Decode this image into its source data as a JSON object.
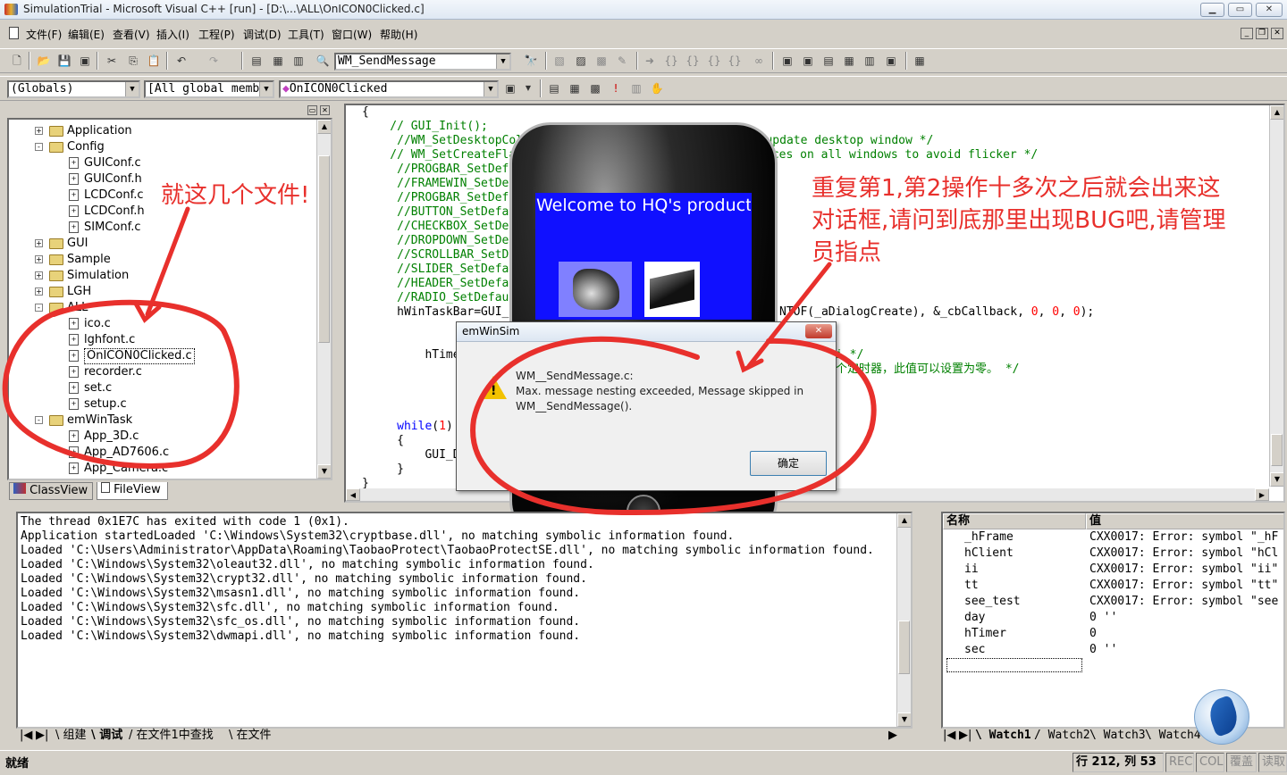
{
  "window": {
    "title": "SimulationTrial - Microsoft Visual C++ [run] - [D:\\...\\ALL\\OnICON0Clicked.c]"
  },
  "menu": [
    "文件(F)",
    "编辑(E)",
    "查看(V)",
    "插入(I)",
    "工程(P)",
    "调试(D)",
    "工具(T)",
    "窗口(W)",
    "帮助(H)"
  ],
  "toolbar": {
    "find_combo": "WM_SendMessage",
    "scope": "(Globals)",
    "members": "[All global members",
    "function": "OnICON0Clicked"
  },
  "tree": [
    {
      "label": "Application",
      "kind": "folder",
      "sign": "+"
    },
    {
      "label": "Config",
      "kind": "folder",
      "sign": "-"
    },
    {
      "label": "GUIConf.c",
      "kind": "file"
    },
    {
      "label": "GUIConf.h",
      "kind": "file"
    },
    {
      "label": "LCDConf.c",
      "kind": "file"
    },
    {
      "label": "LCDConf.h",
      "kind": "file"
    },
    {
      "label": "SIMConf.c",
      "kind": "file"
    },
    {
      "label": "GUI",
      "kind": "folder",
      "sign": "+"
    },
    {
      "label": "Sample",
      "kind": "folder",
      "sign": "+"
    },
    {
      "label": "Simulation",
      "kind": "folder",
      "sign": "+"
    },
    {
      "label": "LGH",
      "kind": "folder",
      "sign": "+"
    },
    {
      "label": "ALL",
      "kind": "folder",
      "sign": "-"
    },
    {
      "label": "ico.c",
      "kind": "file"
    },
    {
      "label": "lghfont.c",
      "kind": "file"
    },
    {
      "label": "OnICON0Clicked.c",
      "kind": "file",
      "selected": true
    },
    {
      "label": "recorder.c",
      "kind": "file"
    },
    {
      "label": "set.c",
      "kind": "file"
    },
    {
      "label": "setup.c",
      "kind": "file"
    },
    {
      "label": "emWinTask",
      "kind": "folder",
      "sign": "-"
    },
    {
      "label": "App_3D.c",
      "kind": "file"
    },
    {
      "label": "App_AD7606.c",
      "kind": "file"
    },
    {
      "label": "App_Camera.c",
      "kind": "file"
    }
  ],
  "tree_tabs": [
    "ClassView",
    "FileView"
  ],
  "code": {
    "l0": "{",
    "l1": "    // GUI_Init();",
    "l2a": "     //WM_SetDesktopColor(",
    "l2b": "ly update desktop window */",
    "l3a": "    // WM_SetCreateFlag",
    "l3b": "ices on all windows to avoid flicker */",
    "l4": "     //PROGBAR_SetDefa",
    "l5": "     //FRAMEWIN_SetDef",
    "l6": "     //PROGBAR_SetDef",
    "l7": "     //BUTTON_SetDefa",
    "l8": "     //CHECKBOX_SetDe",
    "l9": "     //DROPDOWN_SetDe",
    "l10": "     //SCROLLBAR_SetD",
    "l11": "     //SLIDER_SetDefa",
    "l12": "     //HEADER_SetDefa",
    "l13": "     //RADIO_SetDefaul",
    "l14a": "     hWinTaskBar=GUI_",
    "l14b": "NTOF(_aDialogCreate), &_cbCallback, ",
    "l14z": "0",
    "l14c": ");",
    "l15a": "         hTime",
    "l15b": "i */",
    "l16": "个定时器，此值可以设置为零。 */",
    "l17a": "     ",
    "l17kw": "while",
    "l17b": "(",
    "l17one": "1",
    "l17c": ")",
    "l18": "     {",
    "l19": "         GUI_D",
    "l20": "     }",
    "l21": "}"
  },
  "sim": {
    "welcome": "Welcome to HQ's products"
  },
  "dialog": {
    "title": "emWinSim",
    "line1": "WM__SendMessage.c:",
    "line2": "Max. message nesting exceeded, Message skipped in",
    "line3": "WM__SendMessage().",
    "ok": "确定"
  },
  "output": [
    "The thread 0x1E7C has exited with code 1 (0x1).",
    "Application startedLoaded 'C:\\Windows\\System32\\cryptbase.dll', no matching symbolic information found.",
    "Loaded 'C:\\Users\\Administrator\\AppData\\Roaming\\TaobaoProtect\\TaobaoProtectSE.dll', no matching symbolic information found.",
    "Loaded 'C:\\Windows\\System32\\oleaut32.dll', no matching symbolic information found.",
    "Loaded 'C:\\Windows\\System32\\crypt32.dll', no matching symbolic information found.",
    "Loaded 'C:\\Windows\\System32\\msasn1.dll', no matching symbolic information found.",
    "Loaded 'C:\\Windows\\System32\\sfc.dll', no matching symbolic information found.",
    "Loaded 'C:\\Windows\\System32\\sfc_os.dll', no matching symbolic information found.",
    "Loaded 'C:\\Windows\\System32\\dwmapi.dll', no matching symbolic information found."
  ],
  "output_tabs": [
    "组建",
    "调试",
    "在文件1中查找",
    "在文件"
  ],
  "watch": {
    "col_name": "名称",
    "col_value": "值",
    "rows": [
      {
        "name": "_hFrame",
        "value": "CXX0017: Error: symbol \"_hF"
      },
      {
        "name": "hClient",
        "value": "CXX0017: Error: symbol \"hCl"
      },
      {
        "name": "ii",
        "value": "CXX0017: Error: symbol \"ii\""
      },
      {
        "name": "tt",
        "value": "CXX0017: Error: symbol \"tt\""
      },
      {
        "name": "see_test",
        "value": "CXX0017: Error: symbol \"see"
      },
      {
        "name": "day",
        "value": "0 ''"
      },
      {
        "name": "hTimer",
        "value": "0"
      },
      {
        "name": "sec",
        "value": "0 ''"
      }
    ],
    "tabs": [
      "Watch1",
      "Watch2",
      "Watch3",
      "Watch4"
    ]
  },
  "status": {
    "ready": "就绪",
    "pos": "行 212, 列 53",
    "rec": "REC",
    "col": "COL",
    "ovr": "覆盖",
    "ro": "读取"
  },
  "annotations": {
    "left": "就这几个文件!",
    "right1": "重复第1,第2操作十多次之后就会出来这",
    "right2": "对话框,请问到底那里出现BUG吧,请管理",
    "right3": "员指点"
  },
  "colors": {
    "annotation": "#e8302c",
    "sim_screen": "#1010ff",
    "comment": "#008000",
    "keyword": "#0000ff"
  }
}
